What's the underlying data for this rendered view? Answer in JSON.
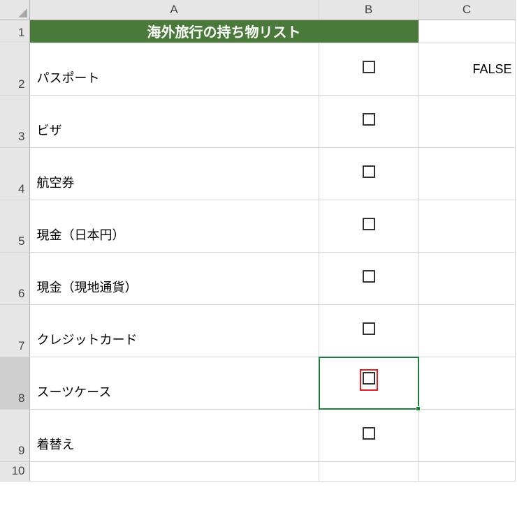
{
  "columns": {
    "A": "A",
    "B": "B",
    "C": "C"
  },
  "rows": {
    "r1": "1",
    "r2": "2",
    "r3": "3",
    "r4": "4",
    "r5": "5",
    "r6": "6",
    "r7": "7",
    "r8": "8",
    "r9": "9",
    "r10": "10"
  },
  "title": "海外旅行の持ち物リスト",
  "items": [
    "パスポート",
    "ビザ",
    "航空券",
    "現金（日本円）",
    "現金（現地通貨）",
    "クレジットカード",
    "スーツケース",
    "着替え"
  ],
  "c2_value": "FALSE",
  "colors": {
    "header_bg": "#4a7a3a",
    "selection": "#1b7f3b",
    "checkbox_highlight": "#e02020"
  }
}
